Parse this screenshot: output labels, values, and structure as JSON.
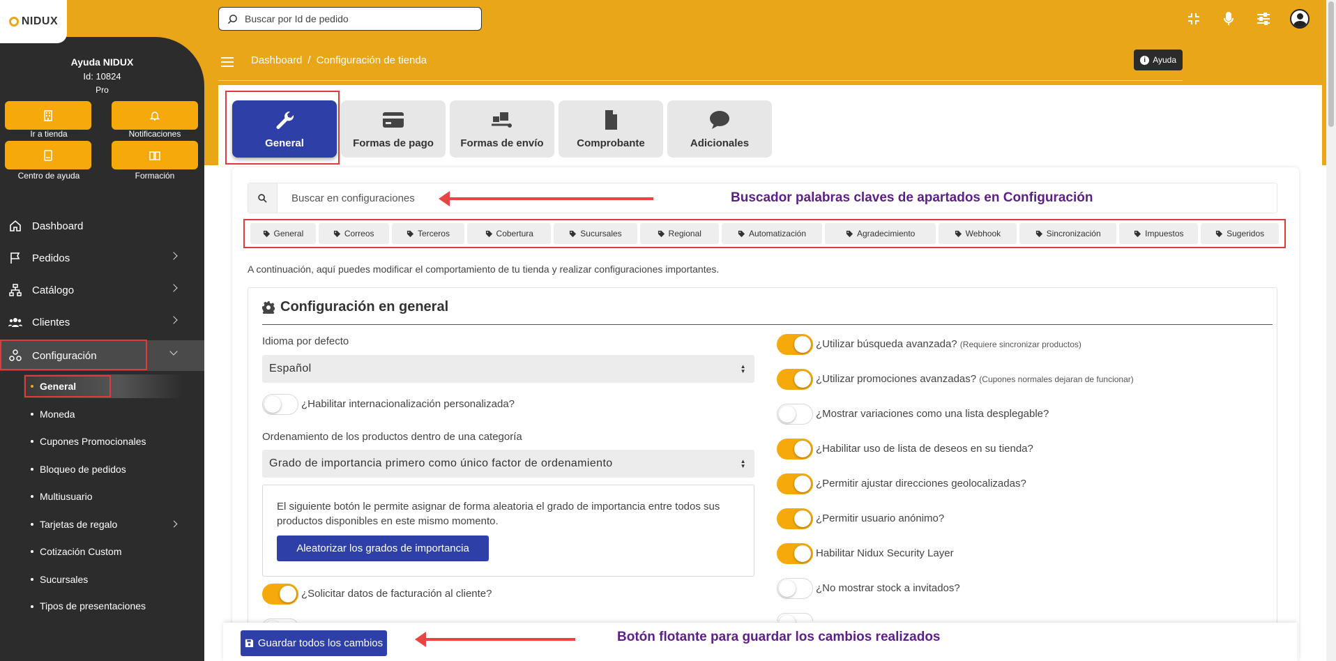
{
  "brand": {
    "logo": "NIDUX",
    "accent": "#e9a619",
    "primary": "#2e40a8",
    "sidebar_bg": "#2c2c2c"
  },
  "topbar": {
    "search_placeholder": "Buscar por Id de pedido",
    "icons": [
      "compress-icon",
      "microphone-icon",
      "sliders-icon",
      "user-avatar-icon"
    ]
  },
  "breadcrumb": {
    "items": [
      "Dashboard",
      "/",
      "Configuración de tienda"
    ]
  },
  "help_button": "Ayuda",
  "profile": {
    "name": "Ayuda NIDUX",
    "id": "Id: 10824",
    "plan": "Pro"
  },
  "quick_links": [
    {
      "label": "Ir a tienda",
      "icon": "building-icon"
    },
    {
      "label": "Notificaciones",
      "icon": "bell-icon"
    },
    {
      "label": "Centro de ayuda",
      "icon": "book-icon"
    },
    {
      "label": "Formación",
      "icon": "open-book-icon"
    }
  ],
  "nav": {
    "items": [
      {
        "label": "Dashboard",
        "icon": "home-icon"
      },
      {
        "label": "Pedidos",
        "icon": "flag-icon"
      },
      {
        "label": "Catálogo",
        "icon": "sitemap-icon"
      },
      {
        "label": "Clientes",
        "icon": "users-icon"
      },
      {
        "label": "Configuración",
        "icon": "settings-icon"
      }
    ],
    "subitems": [
      {
        "label": "General"
      },
      {
        "label": "Moneda"
      },
      {
        "label": "Cupones Promocionales"
      },
      {
        "label": "Bloqueo de pedidos"
      },
      {
        "label": "Multiusuario"
      },
      {
        "label": "Tarjetas de regalo"
      },
      {
        "label": "Cotización Custom"
      },
      {
        "label": "Sucursales"
      },
      {
        "label": "Tipos de presentaciones"
      }
    ]
  },
  "tabs": [
    {
      "label": "General",
      "icon": "wrench-icon"
    },
    {
      "label": "Formas de pago",
      "icon": "credit-card-icon"
    },
    {
      "label": "Formas de envío",
      "icon": "dolly-icon"
    },
    {
      "label": "Comprobante",
      "icon": "file-icon"
    },
    {
      "label": "Adicionales",
      "icon": "comment-icon"
    }
  ],
  "config_search": {
    "placeholder": "Buscar en configuraciones"
  },
  "annotations": {
    "search": "Buscador palabras claves de apartados en Configuración",
    "save": "Botón flotante para guardar los cambios realizados"
  },
  "chips": [
    "General",
    "Correos",
    "Terceros",
    "Cobertura",
    "Sucursales",
    "Regional",
    "Automatización",
    "Agradecimiento",
    "Webhook",
    "Sincronización",
    "Impuestos",
    "Sugeridos"
  ],
  "intro": "A continuación, aquí puedes modificar el comportamiento de tu tienda y realizar configuraciones importantes.",
  "section": {
    "title": "Configuración en general",
    "language_label": "Idioma por defecto",
    "language_value": "Español",
    "intl_label": "¿Habilitar internacionalización personalizada?",
    "intl_on": false,
    "order_label": "Ordenamiento de los productos dentro de una categoría",
    "order_value": "Grado de importancia primero como único factor de ordenamiento",
    "random_text": "El siguiente botón le permite asignar de forma aleatoria el grado de importancia entre todos sus productos disponibles en este mismo momento.",
    "random_button": "Aleatorizar los grados de importancia",
    "billing_label": "¿Solicitar datos de facturación al cliente?",
    "billing_on": true,
    "right_toggles": [
      {
        "label": "¿Utilizar búsqueda avanzada?",
        "note": "(Requiere sincronizar productos)",
        "on": true
      },
      {
        "label": "¿Utilizar promociones avanzadas?",
        "note": "(Cupones normales dejaran de funcionar)",
        "on": true
      },
      {
        "label": "¿Mostrar variaciones como una lista desplegable?",
        "note": "",
        "on": false
      },
      {
        "label": "¿Habilitar uso de lista de deseos en su tienda?",
        "note": "",
        "on": true
      },
      {
        "label": "¿Permitir ajustar direcciones geolocalizadas?",
        "note": "",
        "on": true
      },
      {
        "label": "¿Permitir usuario anónimo?",
        "note": "",
        "on": true
      },
      {
        "label": "Habilitar Nidux Security Layer",
        "note": "",
        "on": true
      },
      {
        "label": "¿No mostrar stock a invitados?",
        "note": "",
        "on": false
      }
    ]
  },
  "save_button": "Guardar todos los cambios"
}
